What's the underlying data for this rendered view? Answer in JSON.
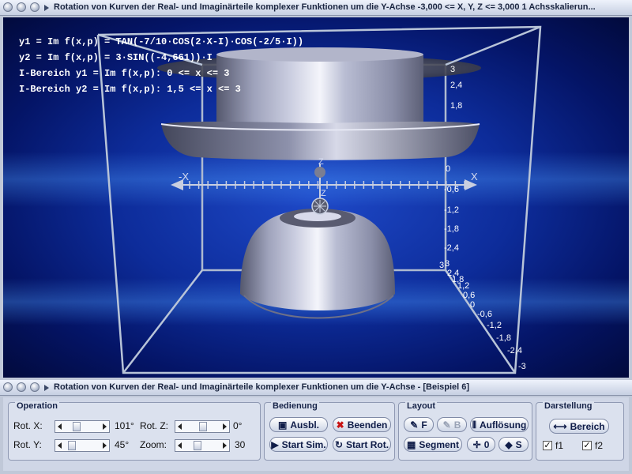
{
  "window_top": {
    "title": "Rotation von Kurven der Real- und Imaginärteile komplexer Funktionen um die Y-Achse    -3,000 <= X, Y, Z <= 3,000    1 Achsskalierun..."
  },
  "viewport": {
    "info_lines": [
      "y1 = Im f(x,p) = TAN(-7/10·COS(2·X-I)·COS(-2/5·I))",
      "y2 = Im f(x,p) = 3·SIN((-4,661))·I",
      "I-Bereich y1 = Im f(x,p): 0 <= x <= 3",
      "I-Bereich y2 = Im f(x,p): 1,5 <= x <= 3"
    ],
    "axis_labels": {
      "minus_x": "-X",
      "plus_x": "X",
      "z_top": "Z",
      "z_bottom": "Z"
    },
    "ticks_right": [
      "3",
      "2,4",
      "1,8",
      "0",
      "-0,6",
      "-1,2",
      "-1,8",
      "-2,4",
      "3"
    ],
    "ticks_front": [
      "3",
      "2,4",
      "1,8",
      "1,2",
      "0,6",
      "0",
      "-0,6",
      "-1,2",
      "-1,8",
      "-2,4",
      "-3"
    ]
  },
  "window_bottom": {
    "title": "Rotation von Kurven der Real- und Imaginärteile komplexer Funktionen um die Y-Achse - [Beispiel 6]"
  },
  "operation": {
    "title": "Operation",
    "rot_x_label": "Rot. X:",
    "rot_x_value": "101°",
    "rot_y_label": "Rot. Y:",
    "rot_y_value": "45°",
    "rot_z_label": "Rot. Z:",
    "rot_z_value": "0°",
    "zoom_label": "Zoom:",
    "zoom_value": "30",
    "rot_x_level": 0.28,
    "rot_y_level": 0.12,
    "rot_z_level": 0.5,
    "zoom_level": 0.3
  },
  "bedienung": {
    "title": "Bedienung",
    "ausbl": "Ausbl.",
    "beenden": "Beenden",
    "start_sim": "Start Sim.",
    "start_rot": "Start Rot."
  },
  "layout": {
    "title": "Layout",
    "f_btn": "F",
    "b_btn": "B",
    "aufloesung": "Auflösung",
    "segment": "Segment",
    "o_btn": "0",
    "s_btn": "S"
  },
  "darstellung": {
    "title": "Darstellung",
    "bereich": "Bereich",
    "f1": "f1",
    "f2": "f2",
    "f1_checked": true,
    "f2_checked": true
  },
  "colors": {
    "background_blue": "#0d2c9a",
    "box_line": "#b8c4d8",
    "surface": "#a9adc6"
  }
}
